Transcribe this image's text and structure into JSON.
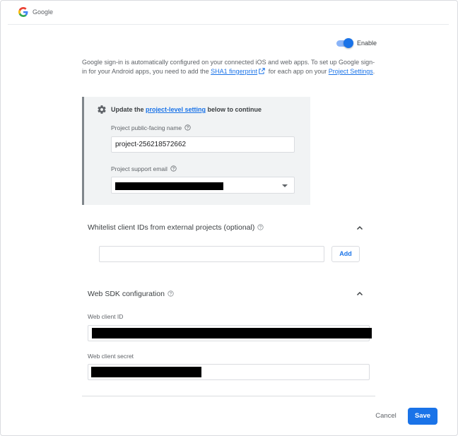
{
  "header": {
    "provider": "Google"
  },
  "toggle": {
    "label": "Enable",
    "enabled": true
  },
  "intro": {
    "text_a": "Google sign-in is automatically configured on your connected iOS and web apps. To set up Google sign-in for your Android apps, you need to add the ",
    "link_sha1": "SHA1 fingerprint",
    "text_b": " for each app on your ",
    "link_project_settings": "Project Settings",
    "text_c": "."
  },
  "callout": {
    "prefix": "Update the ",
    "link": "project-level setting",
    "suffix": " below to continue",
    "public_name_label": "Project public-facing name",
    "public_name_value": "project-256218572662",
    "support_email_label": "Project support email"
  },
  "whitelist": {
    "title": "Whitelist client IDs from external projects (optional)",
    "input_value": "",
    "add_label": "Add"
  },
  "web_sdk": {
    "title": "Web SDK configuration",
    "client_id_label": "Web client ID",
    "client_secret_label": "Web client secret"
  },
  "footer": {
    "cancel_label": "Cancel",
    "save_label": "Save"
  },
  "colors": {
    "accent": "#1a73e8",
    "accent_light": "#8ab4f8",
    "callout_bg": "#f1f3f4"
  }
}
